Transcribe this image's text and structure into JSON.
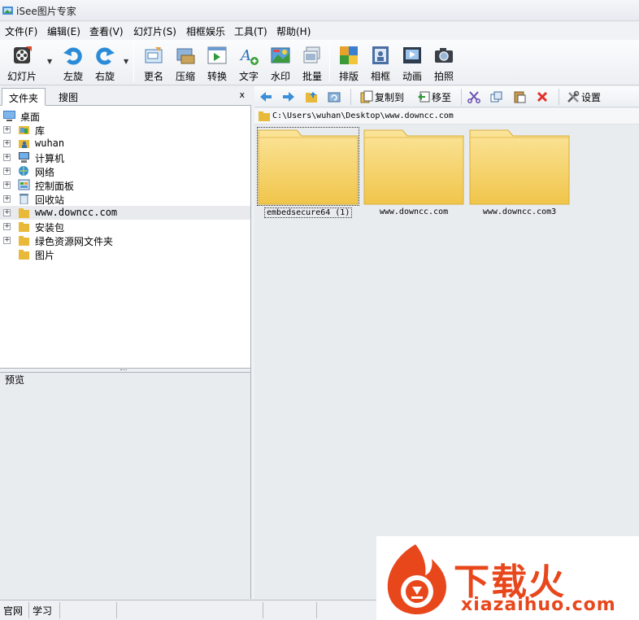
{
  "window": {
    "title": "iSee图片专家"
  },
  "menu": [
    "文件(F)",
    "编辑(E)",
    "查看(V)",
    "幻灯片(S)",
    "相框娱乐",
    "工具(T)",
    "帮助(H)"
  ],
  "toolbar": {
    "slideshow": "幻灯片",
    "rotate_left": "左旋",
    "rotate_right": "右旋",
    "rename": "更名",
    "compress": "压缩",
    "convert": "转换",
    "text": "文字",
    "watermark": "水印",
    "batch": "批量",
    "layout": "排版",
    "frame": "相框",
    "animation": "动画",
    "photo": "拍照"
  },
  "left_tabs": {
    "folders": "文件夹",
    "search": "搜图",
    "close": "x"
  },
  "tree": [
    {
      "label": "桌面",
      "icon": "desktop-icon",
      "expander": false,
      "indent": 0
    },
    {
      "label": "库",
      "icon": "library-icon",
      "expander": true,
      "indent": 1
    },
    {
      "label": "wuhan",
      "icon": "user-folder-icon",
      "expander": true,
      "indent": 1
    },
    {
      "label": "计算机",
      "icon": "computer-icon",
      "expander": true,
      "indent": 1
    },
    {
      "label": "网络",
      "icon": "network-icon",
      "expander": true,
      "indent": 1
    },
    {
      "label": "控制面板",
      "icon": "control-panel-icon",
      "expander": true,
      "indent": 1
    },
    {
      "label": "回收站",
      "icon": "recycle-bin-icon",
      "expander": true,
      "indent": 1
    },
    {
      "label": "www.downcc.com",
      "icon": "folder-icon",
      "expander": true,
      "indent": 1,
      "selected": true
    },
    {
      "label": "安装包",
      "icon": "folder-icon",
      "expander": true,
      "indent": 1
    },
    {
      "label": "绿色资源网文件夹",
      "icon": "folder-icon",
      "expander": true,
      "indent": 1
    },
    {
      "label": "图片",
      "icon": "folder-icon",
      "expander": false,
      "indent": 1
    }
  ],
  "preview": {
    "label": "预览"
  },
  "right_toolbar": {
    "copy_to": "复制到",
    "move_to": "移至",
    "settings": "设置"
  },
  "path": "C:\\Users\\wuhan\\Desktop\\www.downcc.com",
  "files": [
    {
      "name": "embedsecure64 (1)",
      "selected": true
    },
    {
      "name": "www.downcc.com",
      "selected": false
    },
    {
      "name": "www.downcc.com3",
      "selected": false
    }
  ],
  "status": {
    "official_site": "官网",
    "learn": "学习"
  },
  "watermark": {
    "brand": "下载火",
    "url": "xiazaihuo.com"
  },
  "colors": {
    "accent_orange": "#e8471c",
    "folder_yellow": "#f6d46a",
    "selection": "#e8eaed"
  }
}
